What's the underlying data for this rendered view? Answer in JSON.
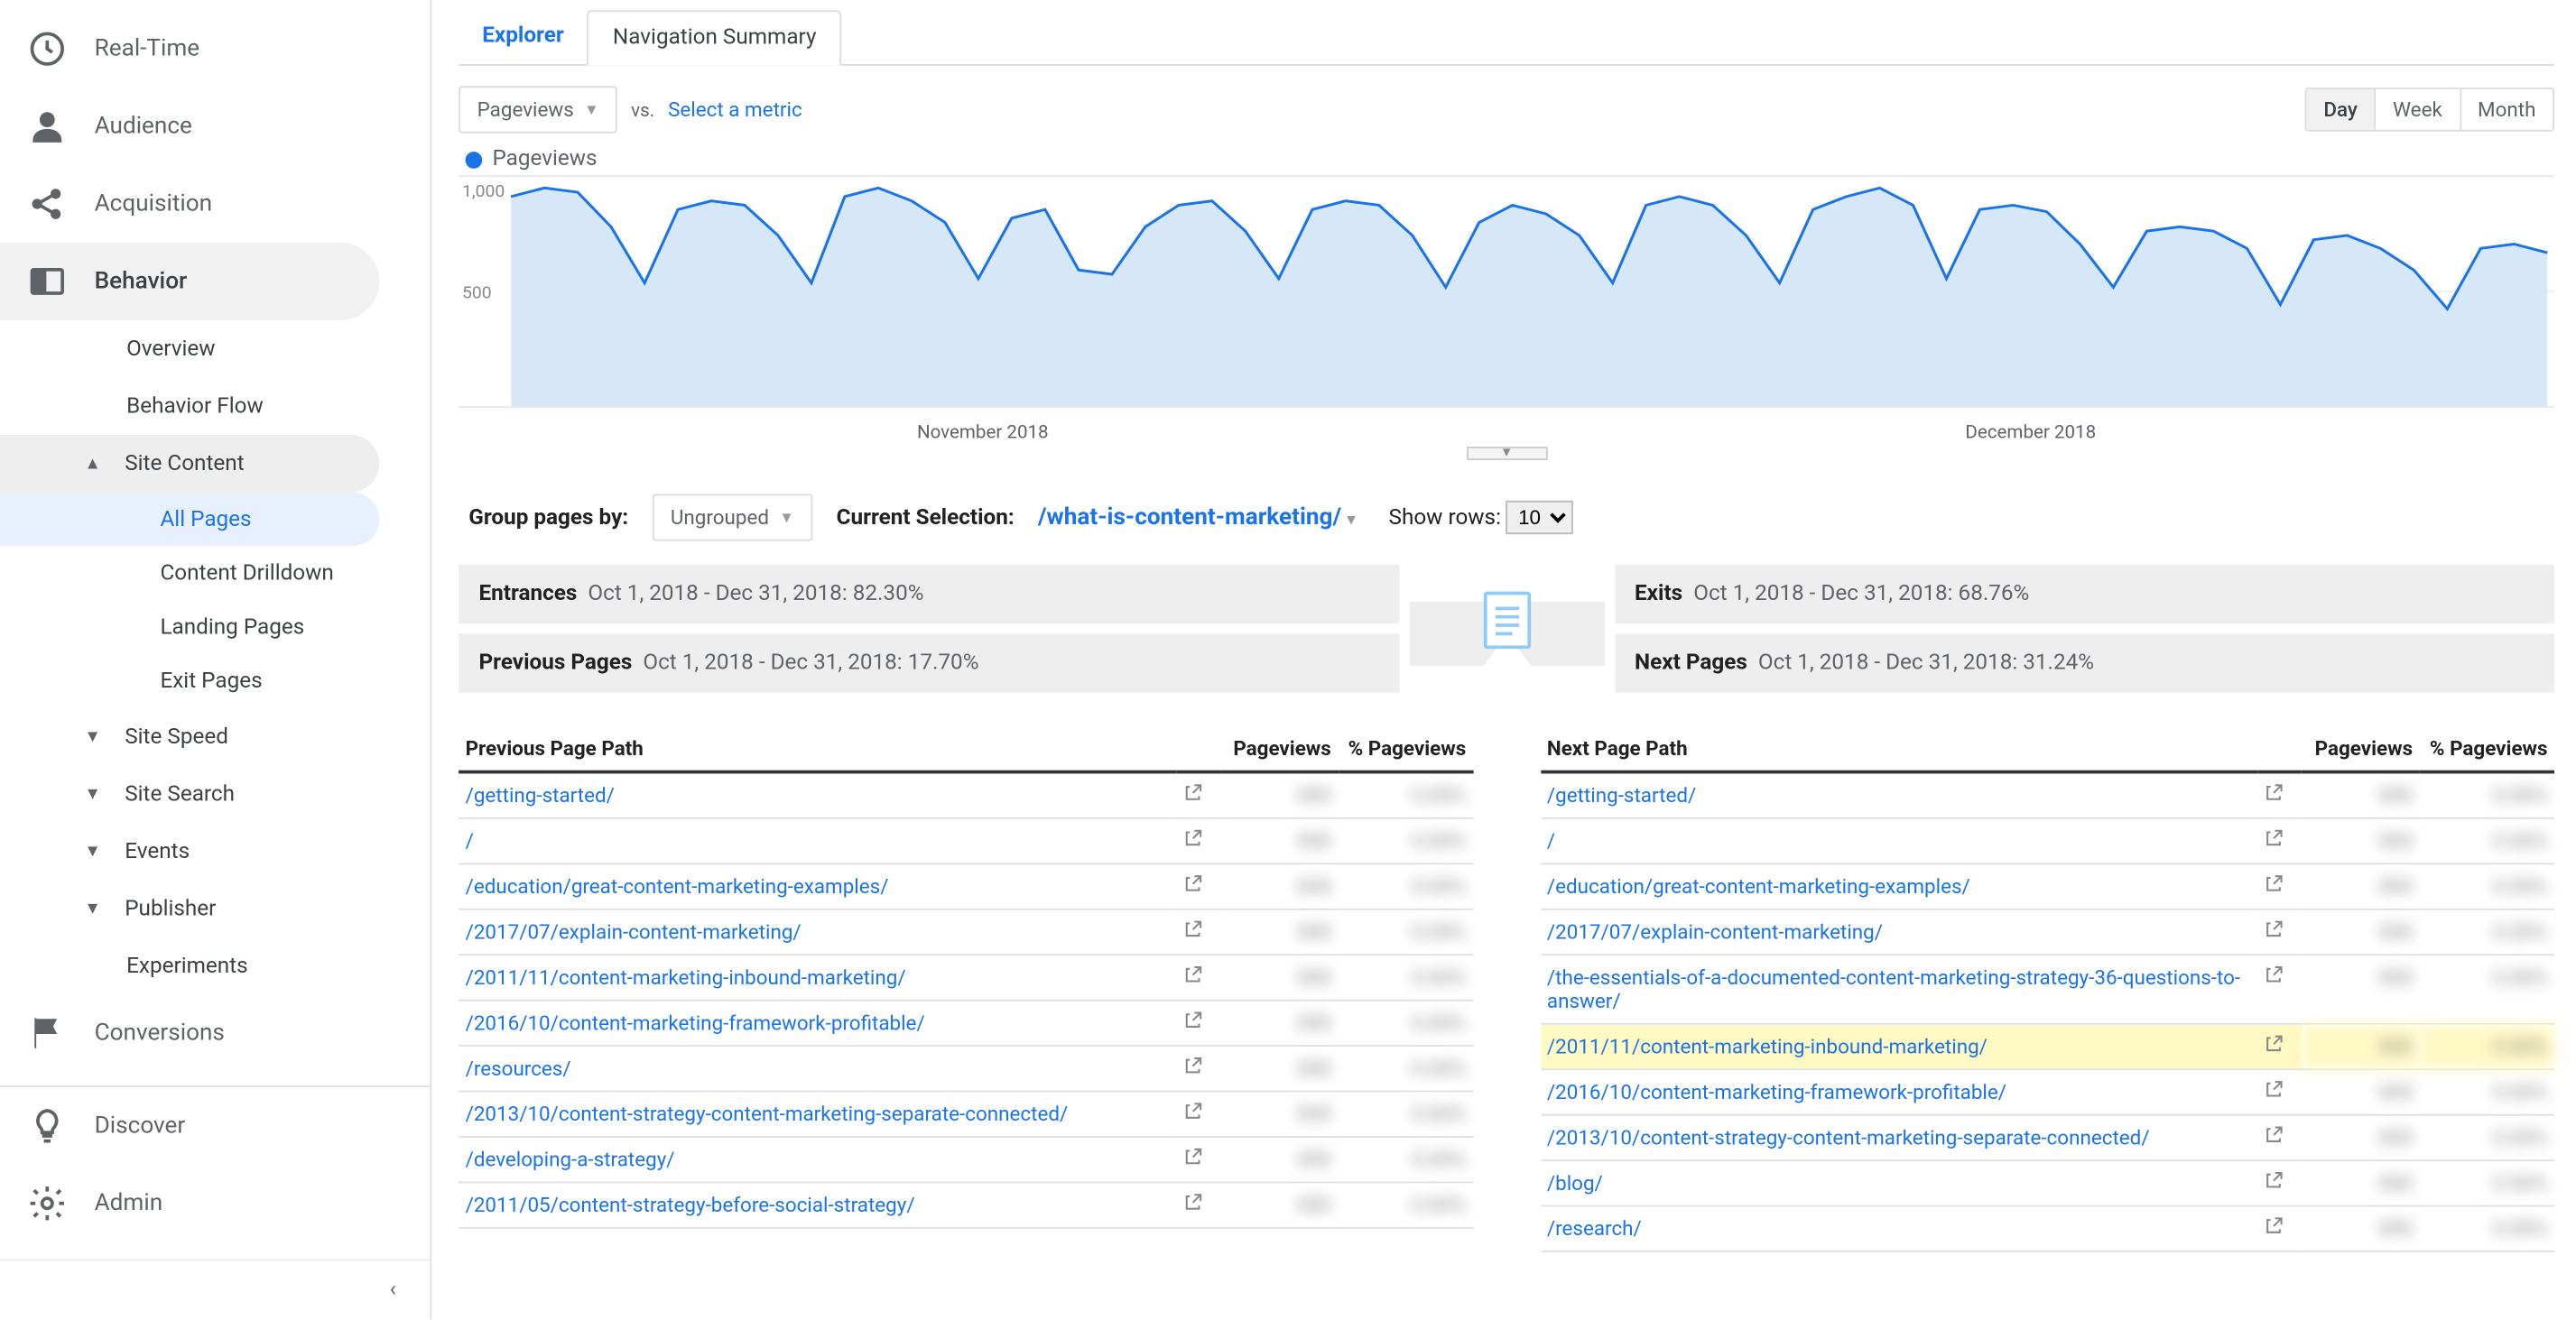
{
  "sidebar": {
    "realtime": "Real-Time",
    "audience": "Audience",
    "acquisition": "Acquisition",
    "behavior": "Behavior",
    "behavior_children": {
      "overview": "Overview",
      "behavior_flow": "Behavior Flow",
      "site_content": "Site Content",
      "site_content_children": {
        "all_pages": "All Pages",
        "content_drilldown": "Content Drilldown",
        "landing_pages": "Landing Pages",
        "exit_pages": "Exit Pages"
      },
      "site_speed": "Site Speed",
      "site_search": "Site Search",
      "events": "Events",
      "publisher": "Publisher",
      "experiments": "Experiments"
    },
    "conversions": "Conversions",
    "discover": "Discover",
    "admin": "Admin"
  },
  "tabs": {
    "explorer": "Explorer",
    "nav_summary": "Navigation Summary"
  },
  "toolbar": {
    "metric_selector": "Pageviews",
    "vs": "vs.",
    "select_metric": "Select a metric",
    "day": "Day",
    "week": "Week",
    "month": "Month"
  },
  "legend": {
    "series": "Pageviews"
  },
  "axis_labels": {
    "nov": "November 2018",
    "dec": "December 2018"
  },
  "controls": {
    "group_by": "Group pages by:",
    "ungrouped": "Ungrouped",
    "current_selection_lbl": "Current Selection:",
    "current_selection": "/what-is-content-marketing/",
    "show_rows": "Show rows:",
    "show_rows_val": "10"
  },
  "flow": {
    "entrances_lbl": "Entrances",
    "entrances_val": "Oct 1, 2018 - Dec 31, 2018: 82.30%",
    "prev_lbl": "Previous Pages",
    "prev_val": "Oct 1, 2018 - Dec 31, 2018: 17.70%",
    "exits_lbl": "Exits",
    "exits_val": "Oct 1, 2018 - Dec 31, 2018: 68.76%",
    "next_lbl": "Next Pages",
    "next_val": "Oct 1, 2018 - Dec 31, 2018: 31.24%"
  },
  "table_headers": {
    "prev_path": "Previous Page Path",
    "next_path": "Next Page Path",
    "pageviews": "Pageviews",
    "pct_pageviews": "% Pageviews"
  },
  "prev_rows": [
    {
      "path": "/getting-started/",
      "pv": "000",
      "pct": "0.00%"
    },
    {
      "path": "/",
      "pv": "000",
      "pct": "0.00%"
    },
    {
      "path": "/education/great-content-marketing-examples/",
      "pv": "000",
      "pct": "0.00%"
    },
    {
      "path": "/2017/07/explain-content-marketing/",
      "pv": "000",
      "pct": "0.00%"
    },
    {
      "path": "/2011/11/content-marketing-inbound-marketing/",
      "pv": "000",
      "pct": "0.00%"
    },
    {
      "path": "/2016/10/content-marketing-framework-profitable/",
      "pv": "000",
      "pct": "0.00%"
    },
    {
      "path": "/resources/",
      "pv": "000",
      "pct": "0.00%"
    },
    {
      "path": "/2013/10/content-strategy-content-marketing-separate-connected/",
      "pv": "000",
      "pct": "0.00%"
    },
    {
      "path": "/developing-a-strategy/",
      "pv": "000",
      "pct": "0.00%"
    },
    {
      "path": "/2011/05/content-strategy-before-social-strategy/",
      "pv": "000",
      "pct": "0.00%"
    }
  ],
  "next_rows": [
    {
      "path": "/getting-started/",
      "pv": "000",
      "pct": "0.00%"
    },
    {
      "path": "/",
      "pv": "000",
      "pct": "0.00%"
    },
    {
      "path": "/education/great-content-marketing-examples/",
      "pv": "000",
      "pct": "0.00%"
    },
    {
      "path": "/2017/07/explain-content-marketing/",
      "pv": "000",
      "pct": "0.00%"
    },
    {
      "path": "/the-essentials-of-a-documented-content-marketing-strategy-36-questions-to-answer/",
      "pv": "000",
      "pct": "0.00%"
    },
    {
      "path": "/2011/11/content-marketing-inbound-marketing/",
      "pv": "000",
      "pct": "0.00%",
      "hl": true
    },
    {
      "path": "/2016/10/content-marketing-framework-profitable/",
      "pv": "000",
      "pct": "0.00%"
    },
    {
      "path": "/2013/10/content-strategy-content-marketing-separate-connected/",
      "pv": "000",
      "pct": "0.00%"
    },
    {
      "path": "/blog/",
      "pv": "000",
      "pct": "0.00%"
    },
    {
      "path": "/research/",
      "pv": "000",
      "pct": "0.00%"
    }
  ],
  "chart_data": {
    "type": "area",
    "title": "",
    "xlabel": "",
    "ylabel": "",
    "ylim": [
      0,
      1000
    ],
    "yticks": [
      500,
      1000
    ],
    "series": [
      {
        "name": "Pageviews",
        "color": "#1a73e8",
        "values": [
          940,
          980,
          960,
          800,
          540,
          880,
          920,
          900,
          760,
          540,
          940,
          980,
          920,
          820,
          560,
          840,
          880,
          600,
          580,
          800,
          900,
          920,
          780,
          560,
          880,
          920,
          900,
          760,
          520,
          820,
          900,
          860,
          760,
          540,
          900,
          940,
          900,
          760,
          540,
          880,
          940,
          980,
          900,
          560,
          880,
          900,
          870,
          720,
          520,
          780,
          800,
          780,
          700,
          440,
          740,
          760,
          700,
          600,
          420,
          700,
          720,
          680
        ]
      }
    ]
  }
}
